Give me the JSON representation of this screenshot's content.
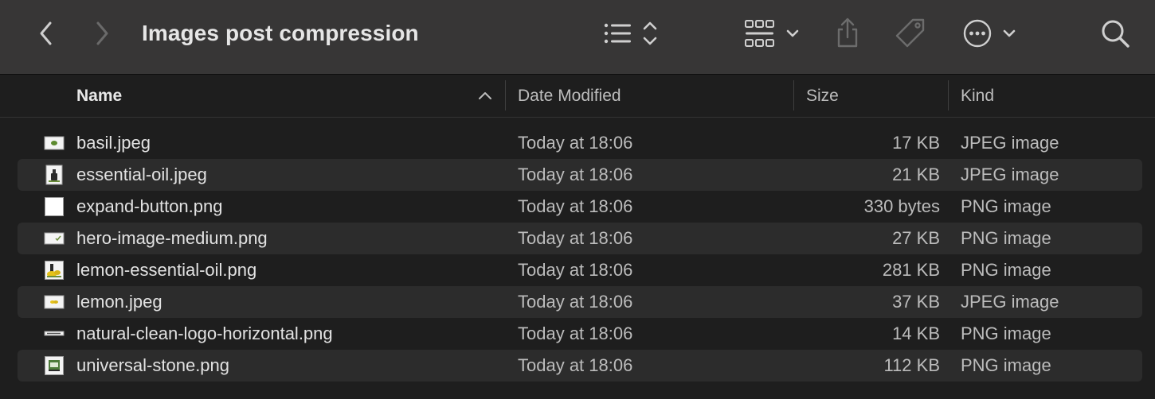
{
  "window": {
    "title": "Images post compression"
  },
  "toolbar": {
    "back_icon": "chevron-left-icon",
    "forward_icon": "chevron-right-icon",
    "view_list_icon": "list-view-icon",
    "group_icon": "grid-group-icon",
    "share_icon": "share-icon",
    "tag_icon": "tag-icon",
    "more_icon": "ellipsis-circle-icon",
    "search_icon": "search-icon"
  },
  "columns": {
    "name": "Name",
    "date": "Date Modified",
    "size": "Size",
    "kind": "Kind"
  },
  "files": [
    {
      "name": "basil.jpeg",
      "date": "Today at 18:06",
      "size": "17 KB",
      "kind": "JPEG image"
    },
    {
      "name": "essential-oil.jpeg",
      "date": "Today at 18:06",
      "size": "21 KB",
      "kind": "JPEG image"
    },
    {
      "name": "expand-button.png",
      "date": "Today at 18:06",
      "size": "330 bytes",
      "kind": "PNG image"
    },
    {
      "name": "hero-image-medium.png",
      "date": "Today at 18:06",
      "size": "27 KB",
      "kind": "PNG image"
    },
    {
      "name": "lemon-essential-oil.png",
      "date": "Today at 18:06",
      "size": "281 KB",
      "kind": "PNG image"
    },
    {
      "name": "lemon.jpeg",
      "date": "Today at 18:06",
      "size": "37 KB",
      "kind": "JPEG image"
    },
    {
      "name": "natural-clean-logo-horizontal.png",
      "date": "Today at 18:06",
      "size": "14 KB",
      "kind": "PNG image"
    },
    {
      "name": "universal-stone.png",
      "date": "Today at 18:06",
      "size": "112 KB",
      "kind": "PNG image"
    }
  ]
}
